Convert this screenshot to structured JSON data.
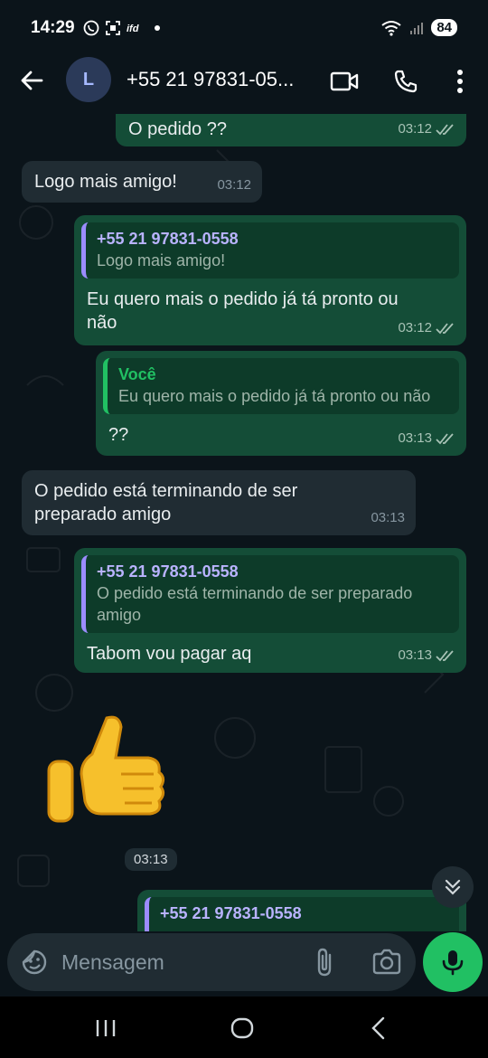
{
  "status_bar": {
    "time": "14:29",
    "battery": "84",
    "icons": [
      "whatsapp-icon",
      "scan-icon",
      "ifood-icon",
      "dot",
      "wifi-icon",
      "signal-icon"
    ]
  },
  "header": {
    "avatar_letter": "L",
    "contact_name": "+55 21 97831-05..."
  },
  "messages": [
    {
      "dir": "out",
      "text": "O pedido ??",
      "time": "03:12"
    },
    {
      "dir": "in",
      "text": "Logo mais amigo!",
      "time": "03:12"
    },
    {
      "dir": "out",
      "quote_name": "+55 21 97831-0558",
      "quote_text": "Logo mais amigo!",
      "text": "Eu quero mais o pedido já tá pronto ou não",
      "time": "03:12"
    },
    {
      "dir": "out",
      "quote_name": "Você",
      "quote_text": "Eu quero mais o pedido já tá pronto ou não",
      "text": "??",
      "time": "03:13"
    },
    {
      "dir": "in",
      "text": "O pedido está terminando de ser preparado amigo",
      "time": "03:13"
    },
    {
      "dir": "out",
      "quote_name": "+55 21 97831-0558",
      "quote_text": "O pedido está terminando de ser preparado amigo",
      "text": "Tabom vou pagar aq",
      "time": "03:13"
    },
    {
      "dir": "out",
      "sticker": "thumbs-up",
      "time": "03:13"
    },
    {
      "dir": "out",
      "quote_name": "+55 21 97831-0558"
    }
  ],
  "composer": {
    "placeholder": "Mensagem"
  },
  "colors": {
    "background": "#0b141a",
    "outgoing_bubble": "#144d37",
    "incoming_bubble": "#202c33",
    "accent_green": "#21c063",
    "quote_bar_purple": "#9b8cff"
  }
}
